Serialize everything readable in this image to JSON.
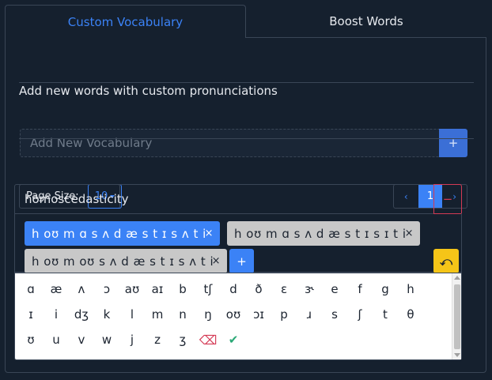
{
  "tabs": [
    {
      "label": "Custom Vocabulary"
    },
    {
      "label": "Boost Words"
    }
  ],
  "subtitle": "Add new words with custom pronunciations",
  "add_vocab": {
    "placeholder": "Add New Vocabulary",
    "button_label": "+"
  },
  "page_size": {
    "label": "Page Size:",
    "value": "10"
  },
  "pagination": {
    "prev": "‹",
    "current": "1",
    "next": "›"
  },
  "entry": {
    "term": "homoscedasticity",
    "delete_label": "−",
    "pronunciations": [
      {
        "text": "h oʊ m ɑ s ʌ d æ s t ɪ s ʌ t i",
        "remove": "×"
      },
      {
        "text": "h oʊ m ɑ s ʌ d æ s t ɪ s ɪ t i",
        "remove": "×"
      },
      {
        "text": "h oʊ m oʊ s ʌ d æ s t ɪ s ʌ t i",
        "remove": "×"
      }
    ],
    "add_label": "+",
    "undo_label": "⤺"
  },
  "keyboard": {
    "rows": [
      [
        "ɑ",
        "æ",
        "ʌ",
        "ɔ",
        "aʊ",
        "aɪ",
        "b",
        "tʃ",
        "d",
        "ð",
        "ɛ",
        "ɝ",
        "e",
        "f",
        "g",
        "h"
      ],
      [
        "ɪ",
        "i",
        "dʒ",
        "k",
        "l",
        "m",
        "n",
        "ŋ",
        "oʊ",
        "ɔɪ",
        "p",
        "ɹ",
        "s",
        "ʃ",
        "t",
        "θ"
      ],
      [
        "ʊ",
        "u",
        "v",
        "w",
        "j",
        "z",
        "ʒ"
      ]
    ],
    "backspace": "⌫",
    "confirm": "✔"
  },
  "colors": {
    "accent": "#3b82f6",
    "danger": "#d43a55",
    "warning": "#f5c518",
    "success": "#2aa876",
    "background": "#15202e"
  }
}
